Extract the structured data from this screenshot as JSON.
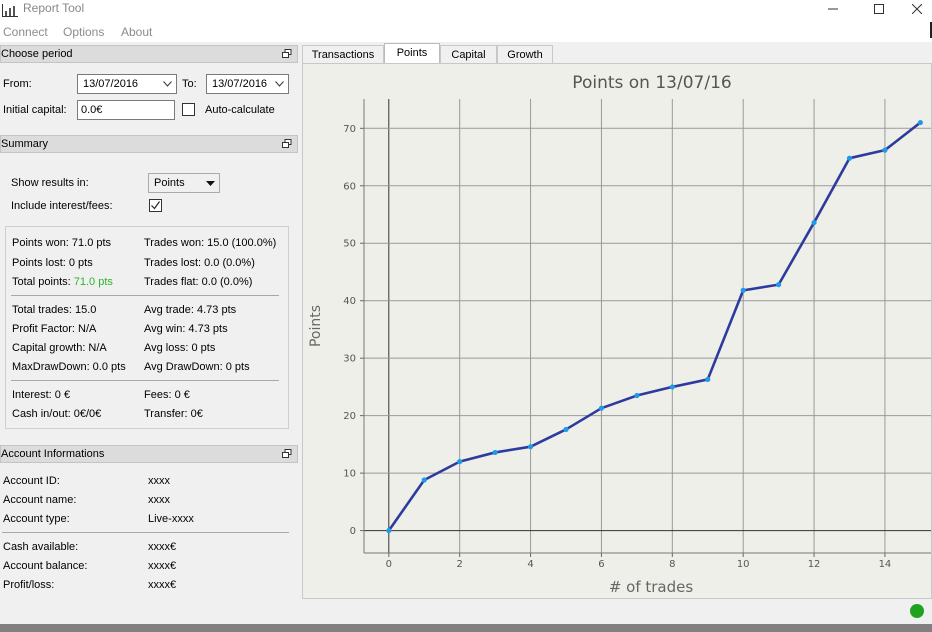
{
  "window": {
    "title": "Report Tool"
  },
  "menu": [
    "Connect",
    "Options",
    "About"
  ],
  "period_panel": {
    "title": "Choose period",
    "from_label": "From:",
    "from_value": "13/07/2016",
    "to_label": "To:",
    "to_value": "13/07/2016",
    "capital_label": "Initial capital:",
    "capital_value": "0.0€",
    "auto_label": "Auto-calculate",
    "auto_checked": false
  },
  "summary_panel": {
    "title": "Summary",
    "show_label": "Show results in:",
    "show_value": "Points",
    "interest_label": "Include interest/fees:",
    "interest_checked": true,
    "left": [
      "Points won: 71.0 pts",
      "Points lost: 0 pts",
      "Total points: ",
      "Total trades: 15.0",
      "Profit Factor: N/A",
      "Capital growth: N/A",
      "MaxDrawDown: 0.0 pts",
      "Interest: 0 €",
      "Cash in/out: 0€/0€"
    ],
    "total_points_value": "71.0 pts",
    "total_points_color": "#2db52d",
    "right": [
      "Trades won: 15.0 (100.0%)",
      "Trades lost: 0.0 (0.0%)",
      "Trades flat: 0.0 (0.0%)",
      "Avg trade: 4.73 pts",
      "Avg win: 4.73 pts",
      "Avg loss: 0 pts",
      "Avg DrawDown: 0 pts",
      "Fees: 0 €",
      "Transfer: 0€"
    ]
  },
  "account_panel": {
    "title": "Account Informations",
    "rows": [
      {
        "label": "Account ID:",
        "value": "xxxx"
      },
      {
        "label": "Account name:",
        "value": "xxxx"
      },
      {
        "label": "Account type:",
        "value": "Live-xxxx"
      },
      {
        "label": "Cash available:",
        "value": "xxxx€"
      },
      {
        "label": "Account balance:",
        "value": "xxxx€"
      },
      {
        "label": "Profit/loss:",
        "value": "xxxx€"
      }
    ]
  },
  "tabs": [
    "Transactions",
    "Points",
    "Capital",
    "Growth"
  ],
  "active_tab": "Points",
  "status": {
    "indicator_color": "#1fa31f"
  },
  "chart_data": {
    "type": "line",
    "title": "Points on 13/07/16",
    "xlabel": "# of trades",
    "ylabel": "Points",
    "x": [
      0,
      1,
      2,
      3,
      4,
      5,
      6,
      7,
      8,
      9,
      10,
      11,
      12,
      13,
      14,
      15
    ],
    "series": [
      {
        "values": [
          0,
          8.8,
          12,
          13.6,
          14.6,
          17.6,
          21.3,
          23.5,
          25,
          26.3,
          41.8,
          42.8,
          53.6,
          64.8,
          66.2,
          71
        ]
      }
    ],
    "xticks": [
      0,
      2,
      4,
      6,
      8,
      10,
      12,
      14
    ],
    "yticks": [
      0,
      10,
      20,
      30,
      40,
      50,
      60,
      70
    ],
    "xlim": [
      -0.7,
      15.3
    ],
    "ylim": [
      -3.9,
      75.1
    ],
    "grid": true,
    "line_color": "#2e3b9e",
    "point_color": "#1e9be6",
    "background": "#efefea"
  }
}
